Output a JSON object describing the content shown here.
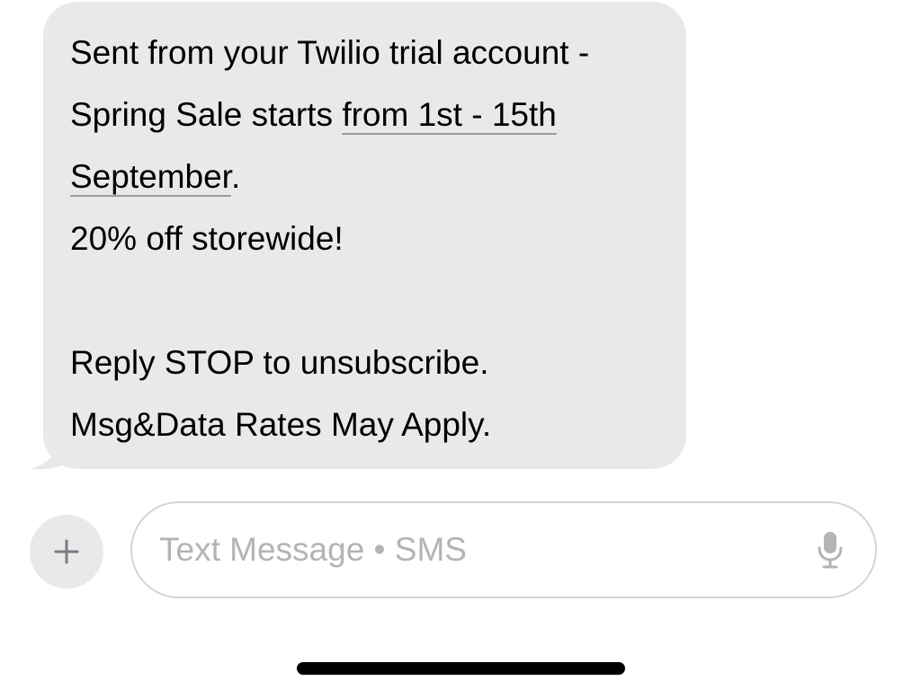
{
  "message": {
    "lines": {
      "l1": "Sent from your Twilio trial account -",
      "l2_prefix": "Spring Sale starts ",
      "l2_link": "from 1st - 15th",
      "l3_link": "September",
      "l3_suffix": ".",
      "l4": "20% off storewide!",
      "l5": "",
      "l6": "Reply STOP to unsubscribe.",
      "l7": "Msg&Data Rates May Apply."
    },
    "bubble_color": "#e9e9eb"
  },
  "composer": {
    "add_icon": "plus-icon",
    "placeholder": "Text Message • SMS",
    "value": "",
    "mic_icon": "microphone-icon"
  },
  "colors": {
    "placeholder": "#b3b3b8",
    "input_border": "#d4d4d8",
    "home_indicator": "#000000"
  }
}
